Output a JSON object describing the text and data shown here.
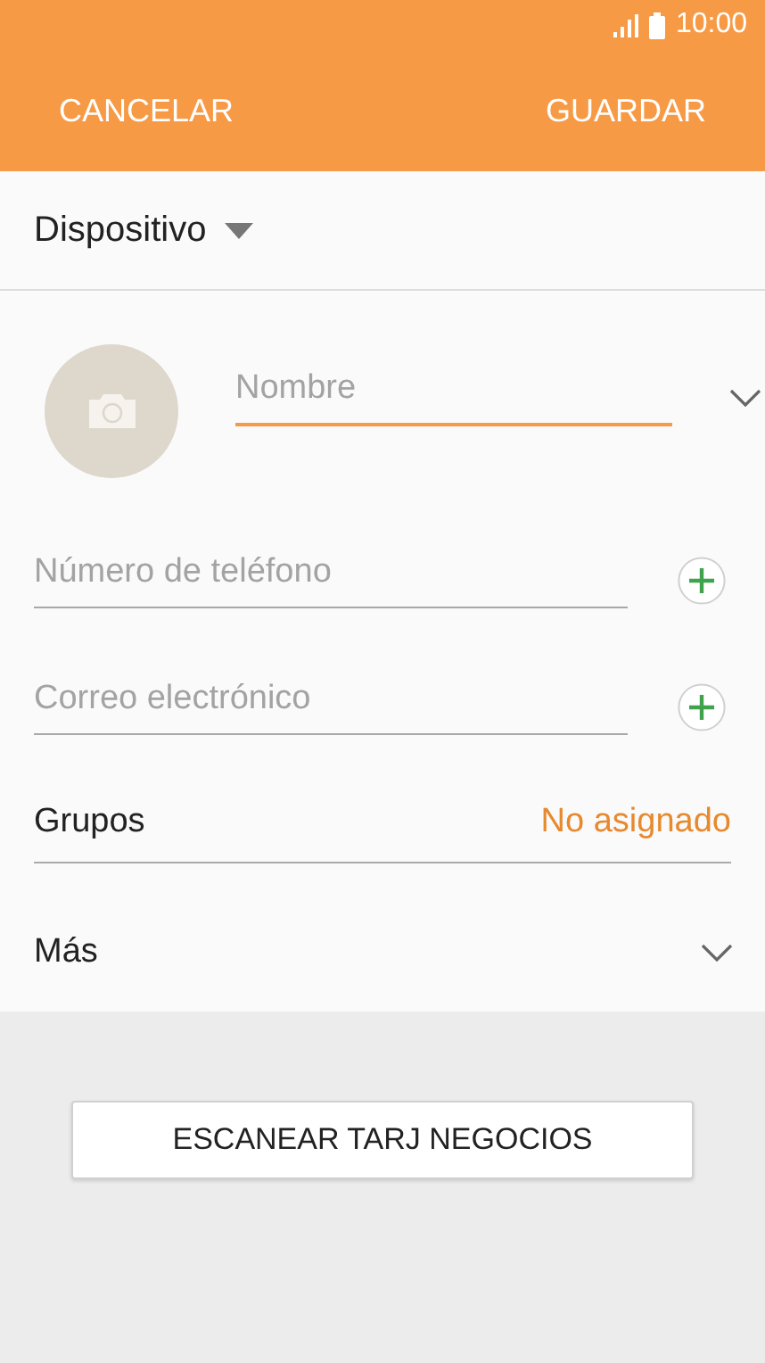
{
  "status_bar": {
    "time": "10:00"
  },
  "header": {
    "buttons": [
      "CANCELAR",
      "GUARDAR"
    ]
  },
  "storage": {
    "label": "Dispositivo"
  },
  "fields": [
    {
      "kind": "name",
      "placeholder": "Nombre",
      "focused": true
    },
    {
      "kind": "phone",
      "placeholder": "Número de teléfono",
      "focused": false
    },
    {
      "kind": "email",
      "placeholder": "Correo electrónico",
      "focused": false
    }
  ],
  "groups": {
    "label": "Grupos",
    "value": "No asignado"
  },
  "more": {
    "label": "Más"
  },
  "scan_button": "ESCANEAR TARJ NEGOCIOS"
}
